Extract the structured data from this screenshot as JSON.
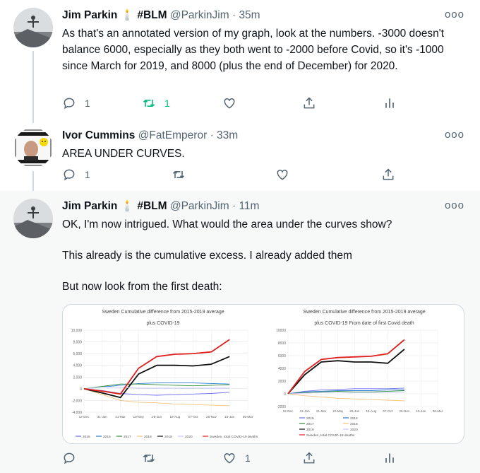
{
  "tweets": [
    {
      "name": "Jim Parkin",
      "badge": "#BLM",
      "handle": "@ParkinJim",
      "time": "35m",
      "text": [
        "As that's an annotated version of my graph, look at the numbers. -3000 doesn't balance 6000, especially as they both went to -2000 before Covid, so it's -1000 since March for 2019, and 8000 (plus the end of December) for 2020."
      ],
      "replies": "1",
      "retweets": "1",
      "likes": ""
    },
    {
      "name": "Ivor Cummins",
      "badge": "",
      "handle": "@FatEmperor",
      "time": "33m",
      "text": [
        "AREA UNDER CURVES."
      ],
      "replies": "1",
      "retweets": "",
      "likes": ""
    },
    {
      "name": "Jim Parkin",
      "badge": "#BLM",
      "handle": "@ParkinJim",
      "time": "11m",
      "text": [
        "OK, I'm now intrigued. What would the area under the curves show?",
        "This already is the cumulative excess. I already added them",
        "But now look from the first death:"
      ],
      "replies": "",
      "retweets": "",
      "likes": "1"
    }
  ],
  "separator": "·",
  "more": "ooo",
  "colors": {
    "accent": "#1d9bf0",
    "retweet_green": "#00ba7c",
    "muted": "#536471",
    "y2015": "#6d6df0",
    "y2016": "#2c7bd6",
    "y2017": "#2e8b3a",
    "y2018": "#f3c27a",
    "y2019": "#111111",
    "y2020": "#c9c9f5",
    "covid": "#e0201e"
  },
  "chart_data": [
    {
      "type": "line",
      "title": "Sweden Cumulative difference from 2015-2019 average",
      "subtitle": "plus COVID-19",
      "x": [
        "12-Dec",
        "31-Jan",
        "21-Mar",
        "10-May",
        "29-Jun",
        "18-Aug",
        "07-Oct",
        "26-Nov",
        "15-Jan",
        "06-Mar"
      ],
      "ylim": [
        -4000,
        10000
      ],
      "yticks": [
        "10,000",
        "8,000",
        "6,000",
        "4,000",
        "2,000",
        "0",
        "-2,000",
        "-4,000"
      ],
      "legend": [
        "2015",
        "2016",
        "2017",
        "2018",
        "2019",
        "2020",
        "Sweden, total COVID-19 deaths"
      ],
      "series": [
        {
          "name": "2015",
          "color": "#6d6df0",
          "values": [
            0,
            -300,
            -800,
            -1000,
            -1100,
            -1000,
            -900,
            -800,
            -600
          ]
        },
        {
          "name": "2016",
          "color": "#2c7bd6",
          "values": [
            0,
            300,
            600,
            900,
            1000,
            1000,
            1000,
            900,
            800
          ]
        },
        {
          "name": "2017",
          "color": "#2e8b3a",
          "values": [
            0,
            400,
            800,
            800,
            700,
            600,
            500,
            600,
            700
          ]
        },
        {
          "name": "2018",
          "color": "#f3c27a",
          "values": [
            0,
            -1000,
            -2000,
            -2300,
            -2400,
            -2600,
            -2700,
            -2800,
            -2900
          ]
        },
        {
          "name": "2019",
          "color": "#111111",
          "values": [
            0,
            -700,
            -1500,
            2500,
            4000,
            4000,
            3900,
            4200,
            5500
          ]
        },
        {
          "name": "2020",
          "color": "#c9c9f5",
          "values": [
            0,
            300,
            200,
            100,
            100,
            100,
            100,
            100,
            100
          ]
        },
        {
          "name": "Sweden, total COVID-19 deaths",
          "color": "#e0201e",
          "values": [
            0,
            -400,
            -900,
            3500,
            5500,
            5900,
            6000,
            6300,
            8400
          ]
        }
      ]
    },
    {
      "type": "line",
      "title": "Sweden Cumulative difference from 2015-2019 average",
      "subtitle": "plus COVID-19  From date of first Covid death",
      "x": [
        "12-Dec",
        "31-Jan",
        "21-Mar",
        "10-May",
        "29-Jun",
        "18-Aug",
        "07-Oct",
        "26-Nov",
        "15-Jan",
        "06-Mar"
      ],
      "ylim": [
        -2000,
        10000
      ],
      "yticks": [
        "10000",
        "8000",
        "6000",
        "4000",
        "2000",
        "0",
        "-2000"
      ],
      "legend": [
        "2015",
        "2016",
        "2017",
        "2018",
        "2019",
        "2020",
        "Sweden, total COVID-19 deaths"
      ],
      "series": [
        {
          "name": "2015",
          "color": "#6d6df0",
          "values": [
            0,
            400,
            600,
            700,
            800,
            800,
            800,
            900
          ]
        },
        {
          "name": "2016",
          "color": "#2c7bd6",
          "values": [
            0,
            300,
            400,
            500,
            500,
            500,
            600,
            600
          ]
        },
        {
          "name": "2017",
          "color": "#2e8b3a",
          "values": [
            0,
            200,
            300,
            400,
            300,
            300,
            400,
            500
          ]
        },
        {
          "name": "2018",
          "color": "#f3c27a",
          "values": [
            0,
            -300,
            -500,
            -700,
            -800,
            -900,
            -1000,
            -1100
          ]
        },
        {
          "name": "2019",
          "color": "#111111",
          "values": [
            0,
            3000,
            5000,
            5200,
            5000,
            5000,
            4800,
            7000
          ]
        },
        {
          "name": "2020",
          "color": "#c9c9f5",
          "values": [
            0,
            100,
            200,
            200,
            200,
            200,
            200,
            200
          ]
        },
        {
          "name": "Sweden, total COVID-19 deaths",
          "color": "#e0201e",
          "values": [
            0,
            3500,
            5400,
            5700,
            5800,
            5900,
            6300,
            8500
          ]
        }
      ]
    }
  ]
}
